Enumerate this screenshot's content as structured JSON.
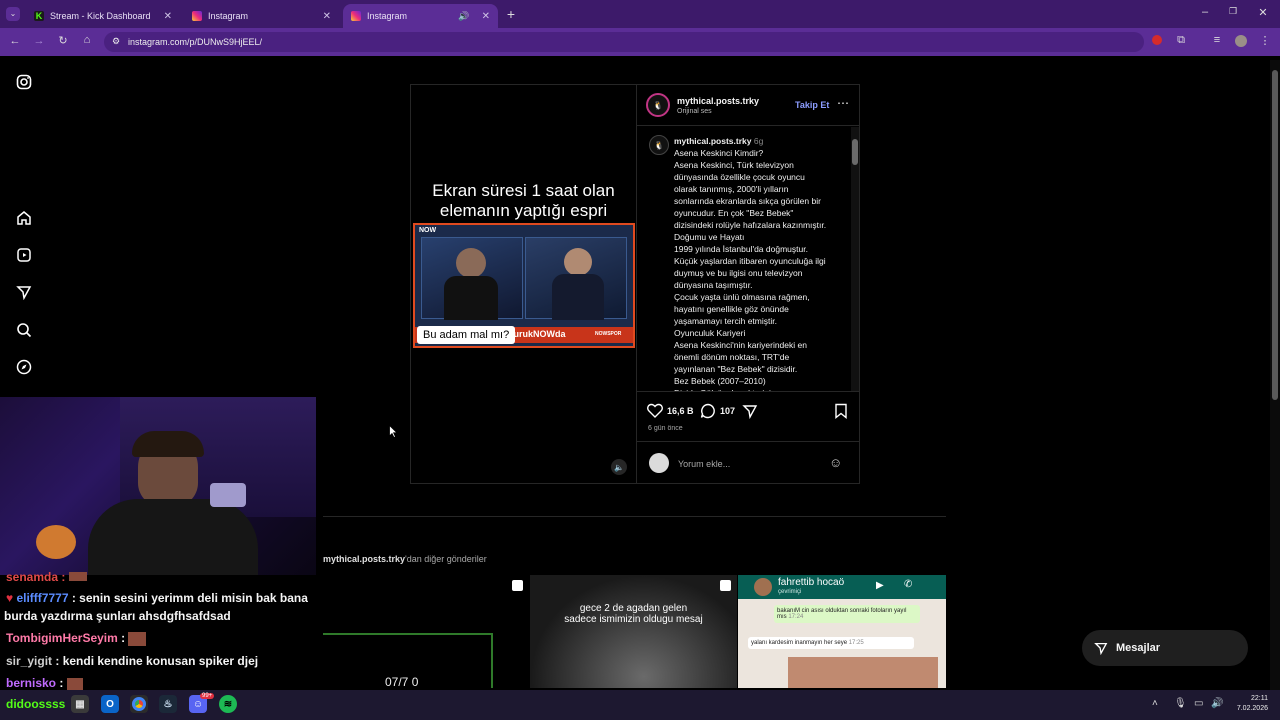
{
  "browser": {
    "tabs": [
      {
        "title": "Stream - Kick Dashboard"
      },
      {
        "title": "Instagram"
      },
      {
        "title": "Instagram"
      }
    ],
    "url": "instagram.com/p/DUNwS9HjEEL/"
  },
  "post": {
    "username": "mythical.posts.trky",
    "audio": "Orijinal ses",
    "follow_label": "Takip Et",
    "media_title_line1": "Ekran süresi 1 saat olan",
    "media_title_line2": "elemanın yaptığı espri",
    "media_caption": "Bu adam mal mı?",
    "media_badge": "NOW",
    "media_ticker": "BurukNOWda",
    "media_ticker_logo": "NOWSPOR",
    "caption_username": "mythical.posts.trky",
    "caption_age": "6g",
    "caption_lines": [
      "Asena Keskinci Kimdir?",
      "Asena Keskinci, Türk televizyon",
      "dünyasında özellikle çocuk oyuncu",
      "olarak tanınmış, 2000'li yılların",
      "sonlarında ekranlarda sıkça görülen bir",
      "oyuncudur. En çok \"Bez Bebek\"",
      "dizisindeki rolüyle hafızalara kazınmıştır.",
      "Doğumu ve Hayatı",
      "1999 yılında İstanbul'da doğmuştur.",
      "Küçük yaşlardan itibaren oyunculuğa ilgi",
      "duymuş ve bu ilgisi onu televizyon",
      "dünyasına taşımıştır.",
      "Çocuk yaşta ünlü olmasına rağmen,",
      "hayatını genellikle göz önünde",
      "yaşamamayı tercih etmiştir.",
      "Oyunculuk Kariyeri",
      "Asena Keskinci'nin kariyerindeki en",
      "önemli dönüm noktası, TRT'de",
      "yayınlanan \"Bez Bebek\" dizisidir.",
      "Bez Bebek (2007–2010)",
      "Dizide Gülsüm karakterini"
    ],
    "likes": "16,6 B",
    "comments": "107",
    "time_ago": "6 gün önce",
    "comment_placeholder": "Yorum ekle..."
  },
  "more": {
    "username": "mythical.posts.trky",
    "suffix": "'dan diğer gönderiler",
    "thumb2_line1": "gece 2 de agadan gelen",
    "thumb2_line2": "sadece ismimizin oldugu mesaj",
    "thumb3_name": "fahrettib hocaö",
    "thumb3_status": "çevrimiçi",
    "thumb3_msg1": "bakanıM cin asısı olduktan sonraki fotoların yayıl mıs",
    "thumb3_time1": "17:24",
    "thumb3_msg2": "yalanı kardesim inanmayın her seye",
    "thumb3_time2": "17:25",
    "thumb1_text": "07/7 0"
  },
  "messages_label": "Mesajlar",
  "chat": [
    {
      "user": "senamda",
      "text": ""
    },
    {
      "user": "elifff7777",
      "text": "senin sesini yerimm deli misin bak bana"
    },
    {
      "user": "",
      "text": "burda yazdırma şunları ahsdgfhsafdsad"
    },
    {
      "user": "TombigimHerSeyim",
      "text": ""
    },
    {
      "user": "sir_yigit",
      "text": "kendi kendine konusan spiker djej"
    },
    {
      "user": "bernisko",
      "text": ""
    },
    {
      "user": "didoossss",
      "text": ""
    }
  ],
  "taskbar": {
    "time": "22:11",
    "date": "7.02.2026",
    "badge": "99+"
  },
  "colors": {
    "tabbar": "#3d1a6a",
    "toolbar": "#5b2d96",
    "link_blue": "#8c9dff"
  }
}
